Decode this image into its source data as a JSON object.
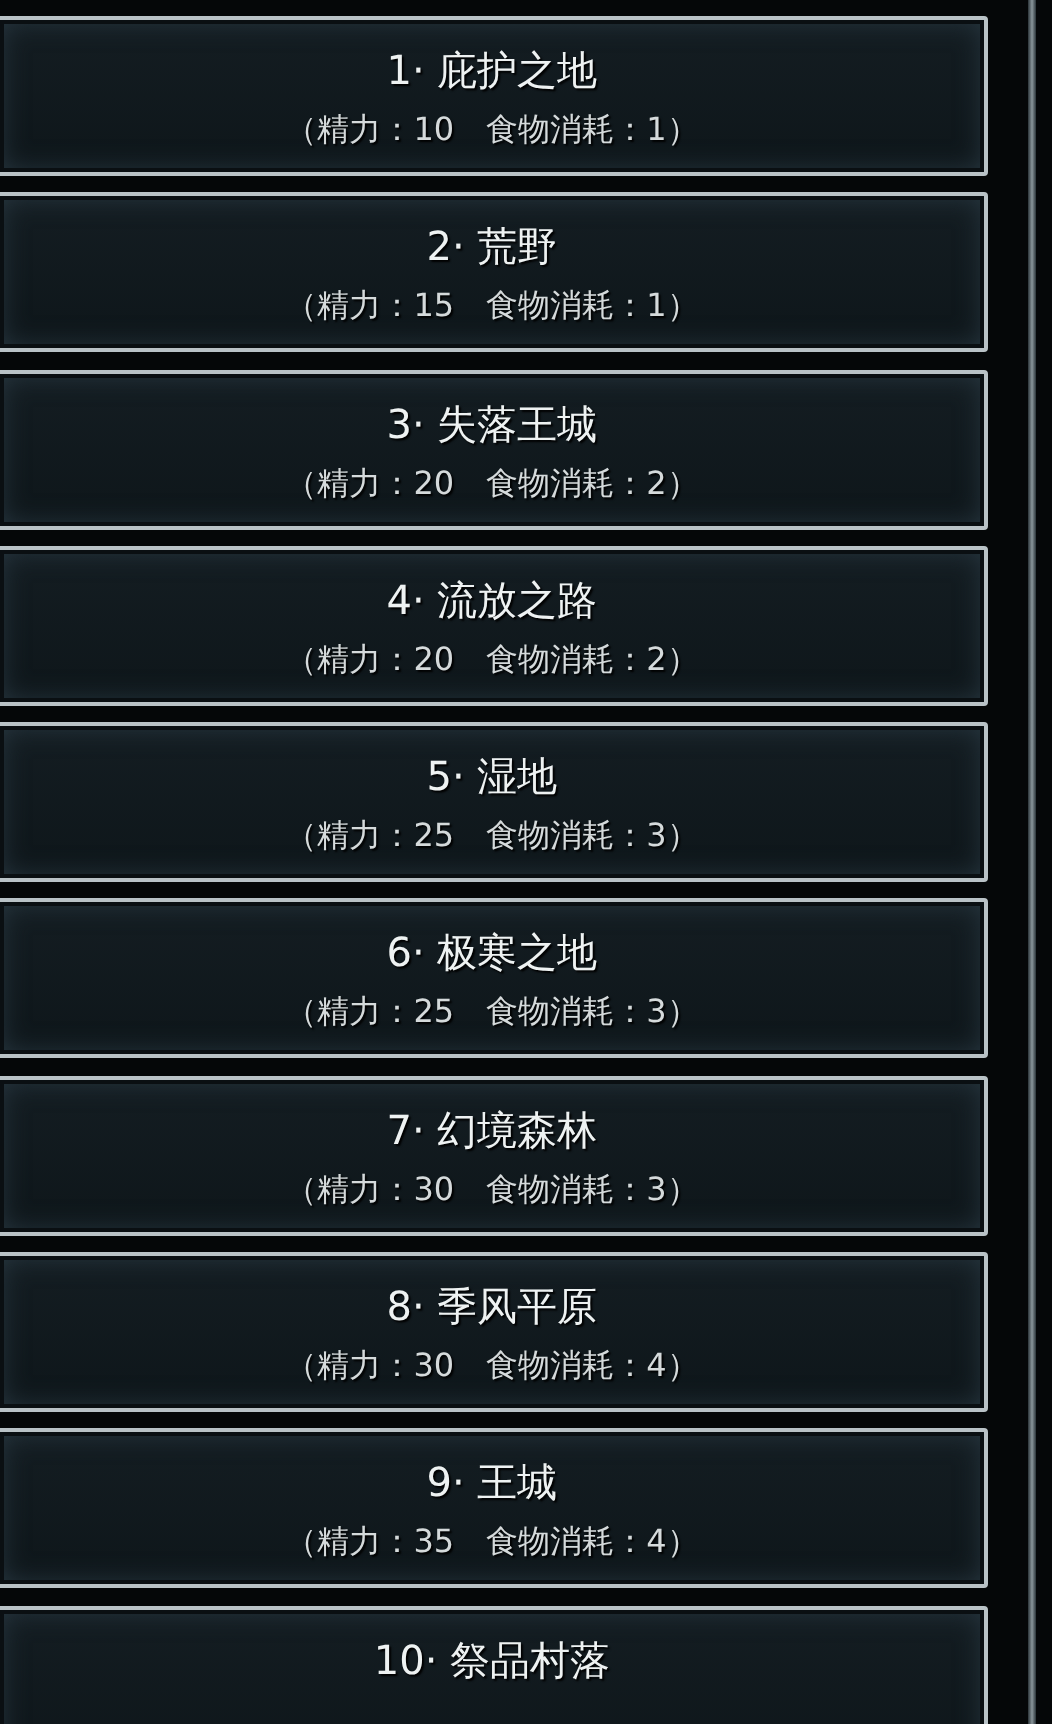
{
  "stages": [
    {
      "title": "1· 庇护之地",
      "cost": "（精力：10　食物消耗：1）"
    },
    {
      "title": "2· 荒野",
      "cost": "（精力：15　食物消耗：1）"
    },
    {
      "title": "3· 失落王城",
      "cost": "（精力：20　食物消耗：2）"
    },
    {
      "title": "4· 流放之路",
      "cost": "（精力：20　食物消耗：2）"
    },
    {
      "title": "5· 湿地",
      "cost": "（精力：25　食物消耗：3）"
    },
    {
      "title": "6· 极寒之地",
      "cost": "（精力：25　食物消耗：3）"
    },
    {
      "title": "7· 幻境森林",
      "cost": "（精力：30　食物消耗：3）"
    },
    {
      "title": "8· 季风平原",
      "cost": "（精力：30　食物消耗：4）"
    },
    {
      "title": "9· 王城",
      "cost": "（精力：35　食物消耗：4）"
    },
    {
      "title": "10· 祭品村落"
    }
  ]
}
